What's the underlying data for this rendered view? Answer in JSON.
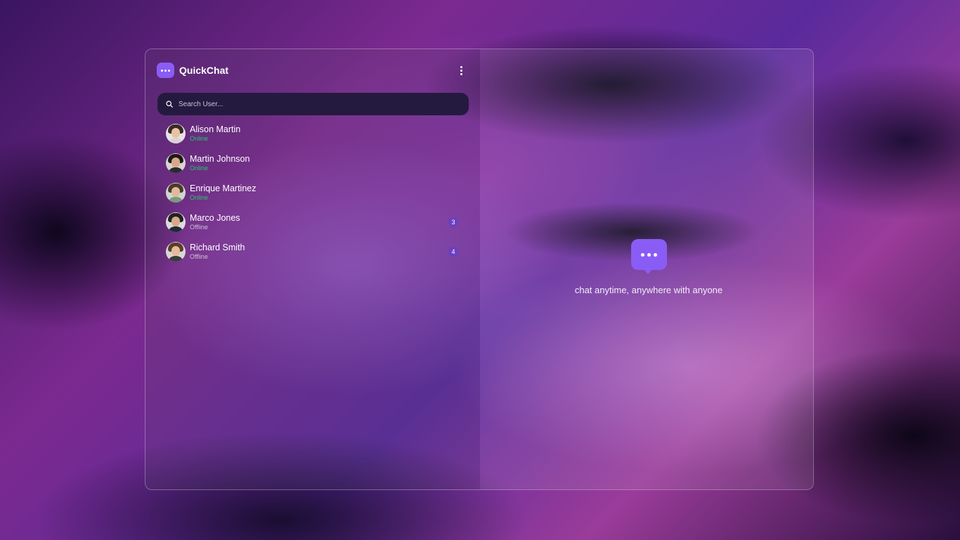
{
  "app": {
    "name": "QuickChat",
    "logo_icon": "chat-bubble-icon",
    "menu_icon": "kebab-menu-icon"
  },
  "search": {
    "placeholder": "Search User...",
    "value": "",
    "icon": "search-icon"
  },
  "users": [
    {
      "name": "Alison Martin",
      "status": "Online",
      "unread": ""
    },
    {
      "name": "Martin Johnson",
      "status": "Online",
      "unread": ""
    },
    {
      "name": "Enrique Martinez",
      "status": "Online",
      "unread": ""
    },
    {
      "name": "Marco Jones",
      "status": "Offline",
      "unread": "3"
    },
    {
      "name": "Richard Smith",
      "status": "Offline",
      "unread": "4"
    }
  ],
  "empty_state": {
    "icon": "chat-bubble-icon",
    "tagline": "chat anytime, anywhere with anyone"
  },
  "colors": {
    "accent": "#8a5cf6",
    "online": "#28c76f",
    "badge": "#6b3fc0",
    "search_bg": "#241a40"
  }
}
